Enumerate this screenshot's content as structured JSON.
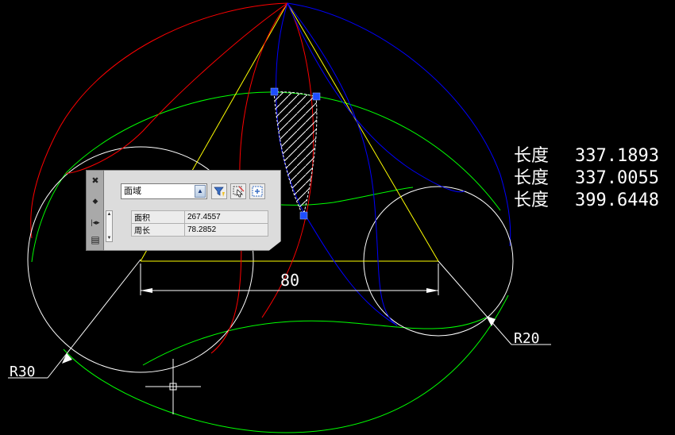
{
  "drawing": {
    "dimension_value": "80",
    "radius_left": "R30",
    "radius_right": "R20"
  },
  "lengths": [
    {
      "label": "长度",
      "value": "337.1893"
    },
    {
      "label": "长度",
      "value": "337.0055"
    },
    {
      "label": "长度",
      "value": "399.6448"
    }
  ],
  "quick_properties": {
    "object_type": "面域",
    "rows": [
      {
        "label": "面积",
        "value": "267.4557"
      },
      {
        "label": "周长",
        "value": "78.2852"
      }
    ],
    "icons": {
      "close": "close-icon",
      "pin": "pin-icon",
      "resize": "resize-icon",
      "properties": "properties-icon",
      "filter": "quick-select-icon",
      "select_objects": "select-objects-icon",
      "toggle_pickadd": "pickadd-icon"
    }
  },
  "colors": {
    "background": "#000000",
    "red_arcs": "#ff0000",
    "blue_arcs": "#0000ff",
    "green_arcs": "#00ff00",
    "yellow_lines": "#ffff00",
    "white_geometry": "#ffffff",
    "grip": "#1e4dff"
  }
}
